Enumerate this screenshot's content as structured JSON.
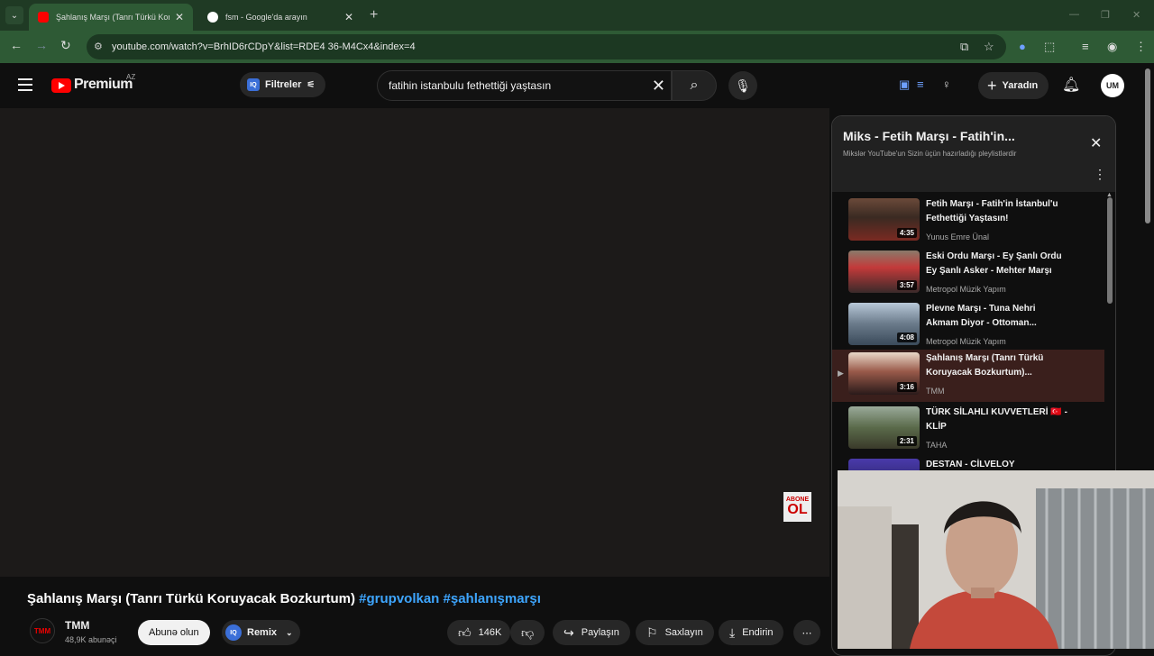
{
  "browser": {
    "tabs": [
      {
        "title": "Şahlanış Marşı (Tanrı Türkü Koruyacak",
        "active": true
      },
      {
        "title": "fsm - Google'da arayın",
        "active": false
      }
    ],
    "address": "youtube.com/watch?v=BrhID6rCDpY&list=RDE4 36-M4Cx4&index=4"
  },
  "masthead": {
    "logo": "Premium",
    "region": "AZ",
    "filters_label": "Filtreler",
    "search_value": "fatihin istanbulu fethettiği yaştasın",
    "create_label": "Yaradın",
    "avatar_initials": "UM"
  },
  "video": {
    "title_main": "Şahlanış Marşı (Tanrı Türkü Koruyacak Bozkurtum)",
    "title_tags": "#grupvolkan #şahlanışmarşı",
    "channel_name": "TMM",
    "channel_logo": "TMM",
    "subscribers": "48,9K abunəçi",
    "subscribe_label": "Abunə olun",
    "remix_label": "Remix",
    "likes": "146K",
    "share_label": "Paylaşın",
    "save_label": "Saxlayın",
    "download_label": "Endirin",
    "watermark_top": "ABONE",
    "watermark_big": "OL"
  },
  "playlist": {
    "title": "Miks - Fetih Marşı - Fatih'in...",
    "subtitle": "Mikslər YouTube'un Sizin üçün hazırladığı pleylistlərdir",
    "items": [
      {
        "title": "Fetih Marşı - Fatih'in İstanbul'u Fethettiği Yaştasın!",
        "channel": "Yunus Emre Ünal",
        "duration": "4:35",
        "current": false
      },
      {
        "title": "Eski Ordu Marşı - Ey Şanlı Ordu Ey Şanlı Asker - Mehter Marşı",
        "channel": "Metropol Müzik Yapım",
        "duration": "3:57",
        "current": false
      },
      {
        "title": "Plevne Marşı - Tuna Nehri Akmam Diyor - Ottoman...",
        "channel": "Metropol Müzik Yapım",
        "duration": "4:08",
        "current": false
      },
      {
        "title": "Şahlanış Marşı (Tanrı Türkü Koruyacak Bozkurtum)...",
        "channel": "TMM",
        "duration": "3:16",
        "current": true
      },
      {
        "title": "TÜRK SİLAHLI KUVVETLERİ 🇹🇷 - KLİP",
        "channel": "TAHA",
        "duration": "2:31",
        "current": false
      },
      {
        "title": "DESTAN - CİLVELOY",
        "channel": "",
        "duration": "",
        "current": false
      }
    ]
  },
  "colors": {
    "accent": "#3ea6ff",
    "brand": "#ff0000",
    "current_item_bg": "#3a1f1c"
  }
}
